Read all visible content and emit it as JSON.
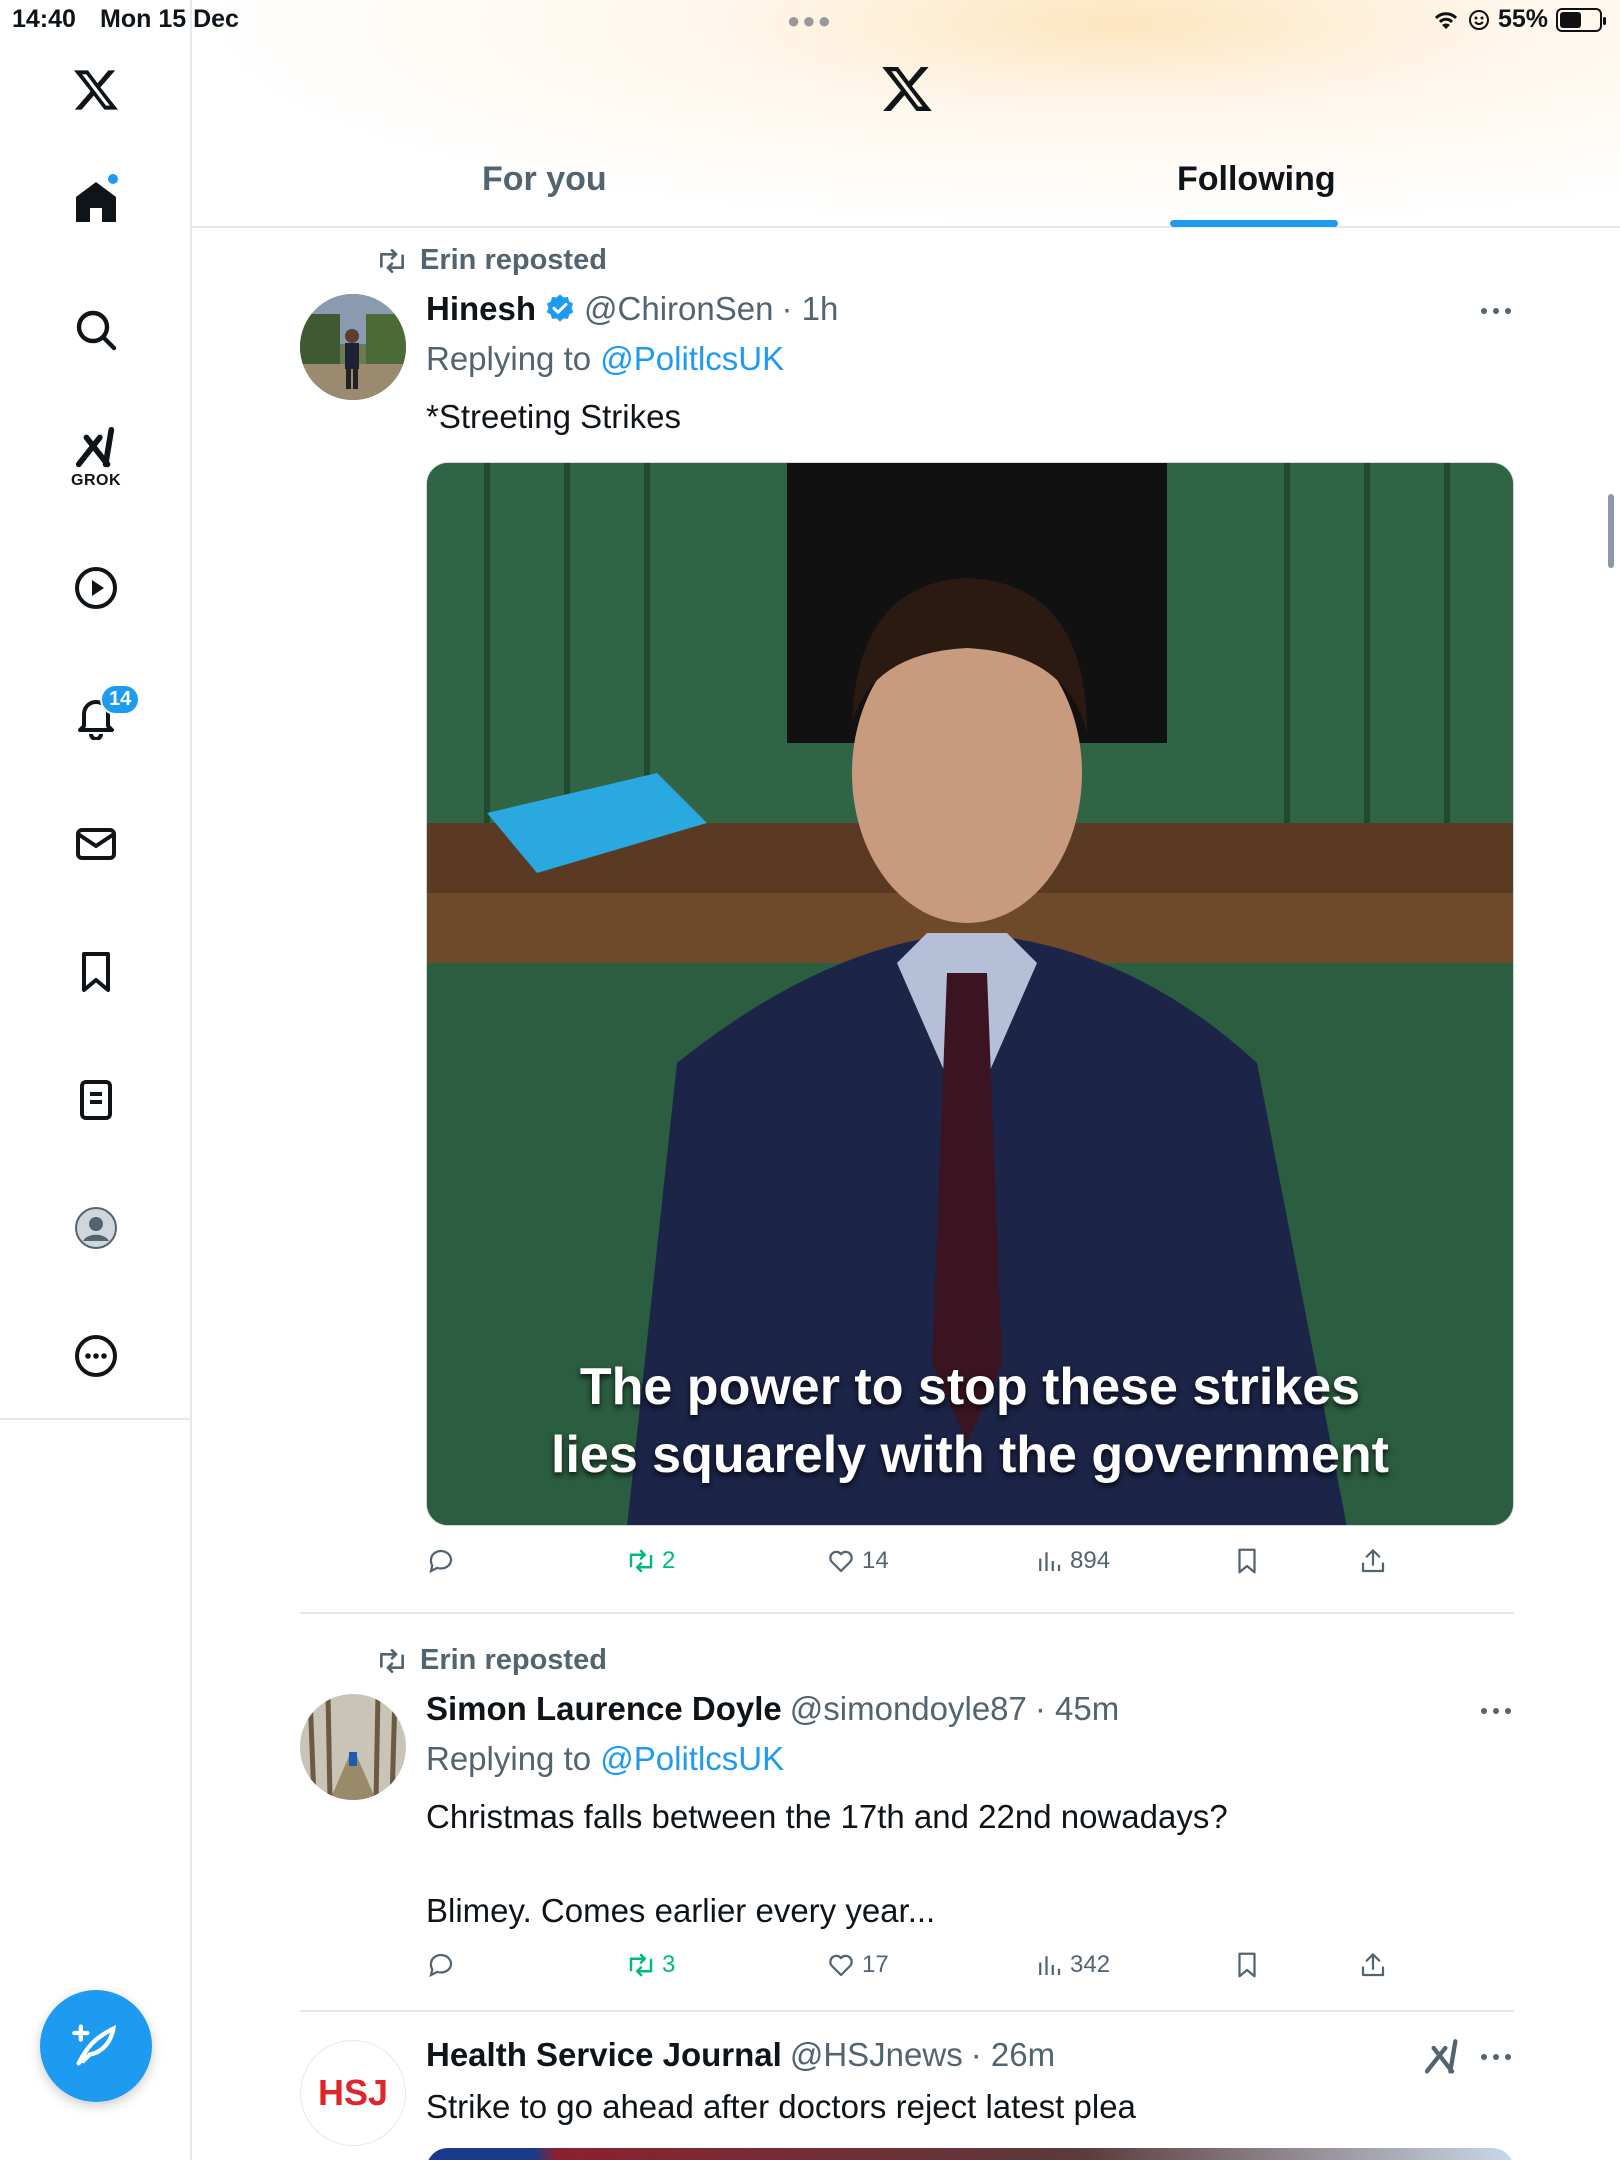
{
  "status_bar": {
    "time": "14:40",
    "date": "Mon 15 Dec",
    "battery": "55%",
    "battery_level": 0.55
  },
  "sidebar": {
    "items": [
      {
        "icon": "x-logo-icon"
      },
      {
        "icon": "home-icon",
        "has_dot": true
      },
      {
        "icon": "search-icon"
      },
      {
        "icon": "grok-icon",
        "label": "GROK"
      },
      {
        "icon": "video-play-icon"
      },
      {
        "icon": "notifications-bell-icon",
        "badge": "14"
      },
      {
        "icon": "messages-envelope-icon"
      },
      {
        "icon": "bookmarks-icon"
      },
      {
        "icon": "lists-icon"
      },
      {
        "icon": "profile-icon"
      },
      {
        "icon": "more-icon"
      }
    ],
    "compose_icon": "compose-feather-icon"
  },
  "header": {
    "tabs": [
      {
        "label": "For you",
        "active": false
      },
      {
        "label": "Following",
        "active": true
      }
    ],
    "accent": "#1d9bf0"
  },
  "feed": {
    "posts": [
      {
        "repost_by": "Erin reposted",
        "name": "Hinesh",
        "verified": true,
        "handle": "@ChironSen",
        "time": "· 1h",
        "replying_prefix": "Replying to",
        "replying_to": "@PolitlcsUK",
        "text": "*Streeting Strikes",
        "media_caption_line1": "The power to stop these strikes",
        "media_caption_line2": "lies squarely with the government",
        "actions": {
          "reposts": "2",
          "likes": "14",
          "views": "894"
        }
      },
      {
        "repost_by": "Erin reposted",
        "name": "Simon Laurence Doyle",
        "handle": "@simondoyle87",
        "time": "· 45m",
        "replying_prefix": "Replying to",
        "replying_to": "@PolitlcsUK",
        "text_line1": "Christmas falls between the 17th and 22nd nowadays?",
        "text_line2": "Blimey. Comes earlier every year...",
        "actions": {
          "reposts": "3",
          "likes": "17",
          "views": "342"
        }
      },
      {
        "name": "Health Service Journal",
        "handle": "@HSJnews",
        "time": "· 26m",
        "avatar_text": "HSJ",
        "text": "Strike to go ahead after doctors reject latest plea"
      }
    ]
  },
  "colors": {
    "link": "#1d9bf0",
    "secondary": "#536471",
    "repost_green": "#00ba7c"
  }
}
